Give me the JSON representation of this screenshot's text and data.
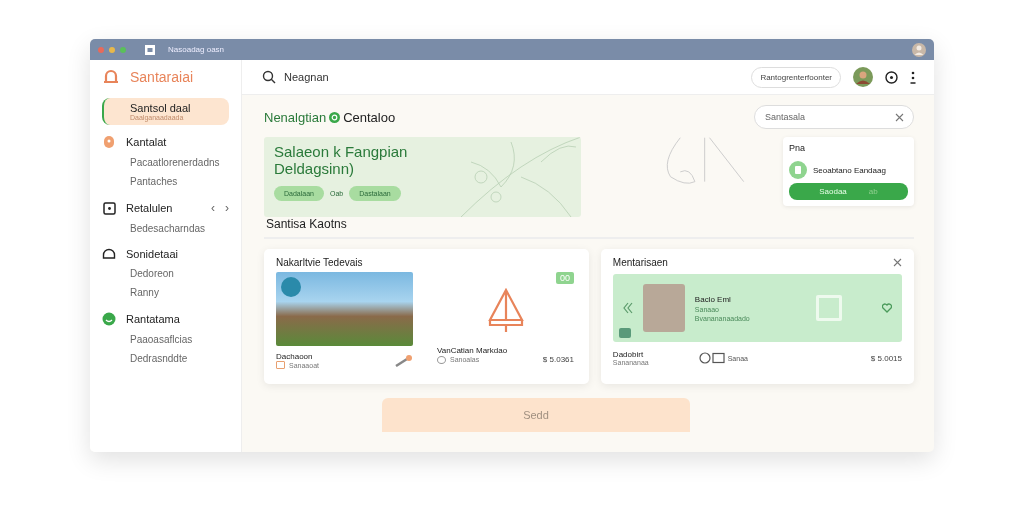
{
  "window": {
    "title": "Nasoadag oasn"
  },
  "sidebar": {
    "brand": "Santaraiai",
    "items": [
      {
        "label": "Santsol daal",
        "sub": "Daalganaadaada",
        "selected": true
      },
      {
        "label": "Kantalat",
        "selected": false,
        "children": [
          "Pacaatlorenerdadns",
          "Pantaches"
        ]
      },
      {
        "label": "Retalulen",
        "selected": false,
        "arrows": [
          "‹",
          "›"
        ],
        "children": [
          "Bedesacharndas"
        ]
      },
      {
        "label": "Sonidetaai",
        "selected": false,
        "children": [
          "Dedoreon",
          "Ranny"
        ]
      },
      {
        "label": "Rantatama",
        "selected": false,
        "children": [
          "Paaoasaflcias",
          "Dedrasnddte"
        ]
      }
    ]
  },
  "topbar": {
    "search_placeholder": "Neagnan",
    "button": "Rantogrenterfoonter"
  },
  "heading": {
    "left": "Nenalgtian",
    "right": "Centaloo"
  },
  "filter": {
    "placeholder": "Santasala"
  },
  "banner": {
    "title": "Salaeon k Fangpian Deldagsinn)",
    "chips": [
      "Dadalaan",
      "Dastalaan"
    ],
    "between": "Oab"
  },
  "side_card": {
    "title": "Pna",
    "item": "Seoabtano Eandaag",
    "button": "Saodaa",
    "button_hint": "ab"
  },
  "section_title": "Santisa Kaotns",
  "card_left": {
    "title": "Nakarltvie Tedevais",
    "chip": "00",
    "items": [
      {
        "title": "Dachaoon",
        "meta": "Sanaaoat"
      },
      {
        "title": "VanCatian Markdao",
        "meta": "Sanoalas"
      }
    ],
    "price": "$ 5.0361"
  },
  "card_right": {
    "title": "Mentarisaen",
    "person": {
      "name": "Baclo Eml",
      "line1": "Sanaao",
      "line2": "Bvanananaadado"
    },
    "footer_title": "Dadobirt",
    "footer_meta": "Sanananaa",
    "stat": "Sanaa",
    "price": "$ 5.0015"
  },
  "bottom_button": "Sedd"
}
